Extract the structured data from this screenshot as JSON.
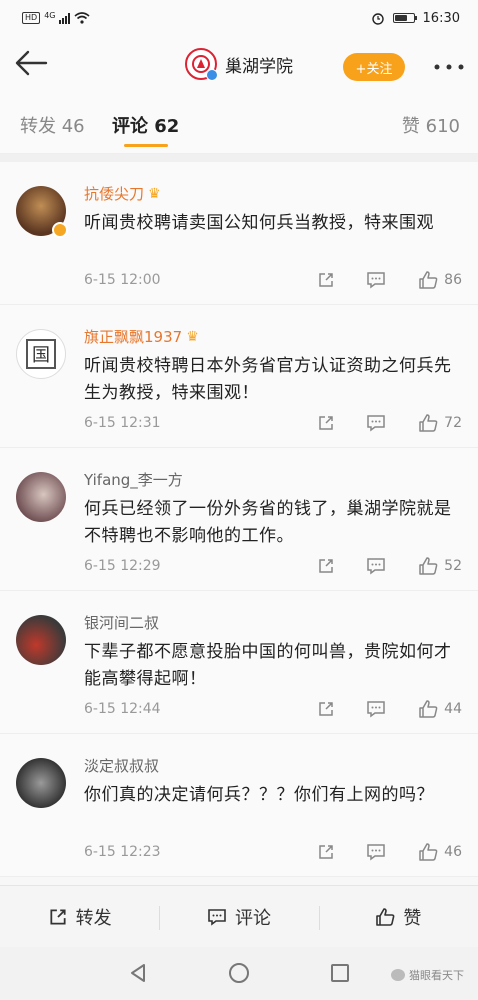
{
  "status_bar": {
    "network_label": "HD",
    "network_type": "4G",
    "time": "16:30",
    "battery_level": 0.7
  },
  "header": {
    "title": "巢湖学院",
    "follow_label": "+关注",
    "logo_icon": "school-logo-icon"
  },
  "tabs": {
    "repost": "转发 46",
    "comment": "评论 62",
    "like": "赞 610",
    "active": "comment"
  },
  "comments": [
    {
      "name": "抗倭尖刀",
      "crown": "♛",
      "text": "听闻贵校聘请卖国公知何兵当教授，特来围观",
      "time": "6-15 12:00",
      "likes": "86"
    },
    {
      "name": "旗正飘飘1937",
      "crown": "♛",
      "avatar_char": "国",
      "text": "听闻贵校特聘日本外务省官方认证资助之何兵先生为教授，特来围观！",
      "time": "6-15 12:31",
      "likes": "72"
    },
    {
      "name": "Yifang_李一方",
      "text": "何兵已经领了一份外务省的钱了，巢湖学院就是不特聘也不影响他的工作。",
      "time": "6-15 12:29",
      "likes": "52"
    },
    {
      "name": "银河间二叔",
      "text": "下辈子都不愿意投胎中国的何叫兽，贵院如何才能高攀得起啊！",
      "time": "6-15 12:44",
      "likes": "44"
    },
    {
      "name": "淡定叔叔叔",
      "text": "你们真的决定请何兵？？？你们有上网的吗？",
      "time": "6-15 12:23",
      "likes": "46"
    }
  ],
  "bottom_bar": {
    "repost": "转发",
    "comment": "评论",
    "like": "赞"
  },
  "watermark": "猫眼看天下",
  "colors": {
    "accent": "#f8a21b",
    "vip_name": "#e8772e"
  }
}
